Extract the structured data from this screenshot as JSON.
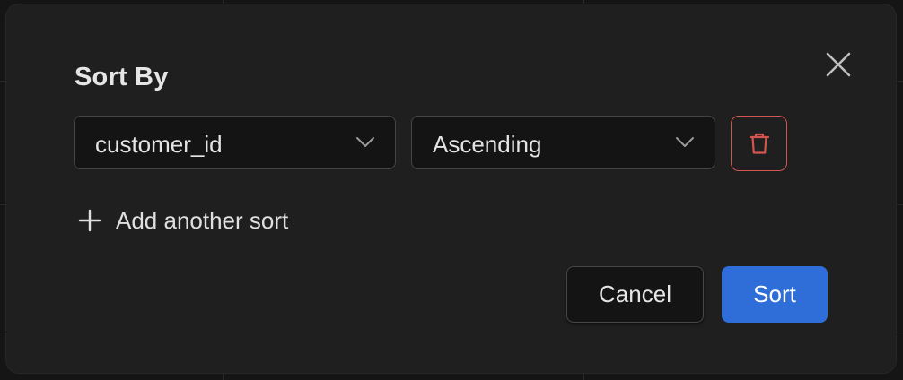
{
  "modal": {
    "title": "Sort By",
    "close_icon": "close-icon",
    "sort_rows": [
      {
        "field": "customer_id",
        "order": "Ascending",
        "delete_icon": "trash-icon"
      }
    ],
    "add_sort_label": "Add another sort",
    "add_icon": "plus-icon",
    "cancel_label": "Cancel",
    "sort_label": "Sort"
  },
  "colors": {
    "background": "#1f1f1f",
    "primary": "#2f6ed8",
    "danger": "#d2554f",
    "input_bg": "#141414"
  }
}
